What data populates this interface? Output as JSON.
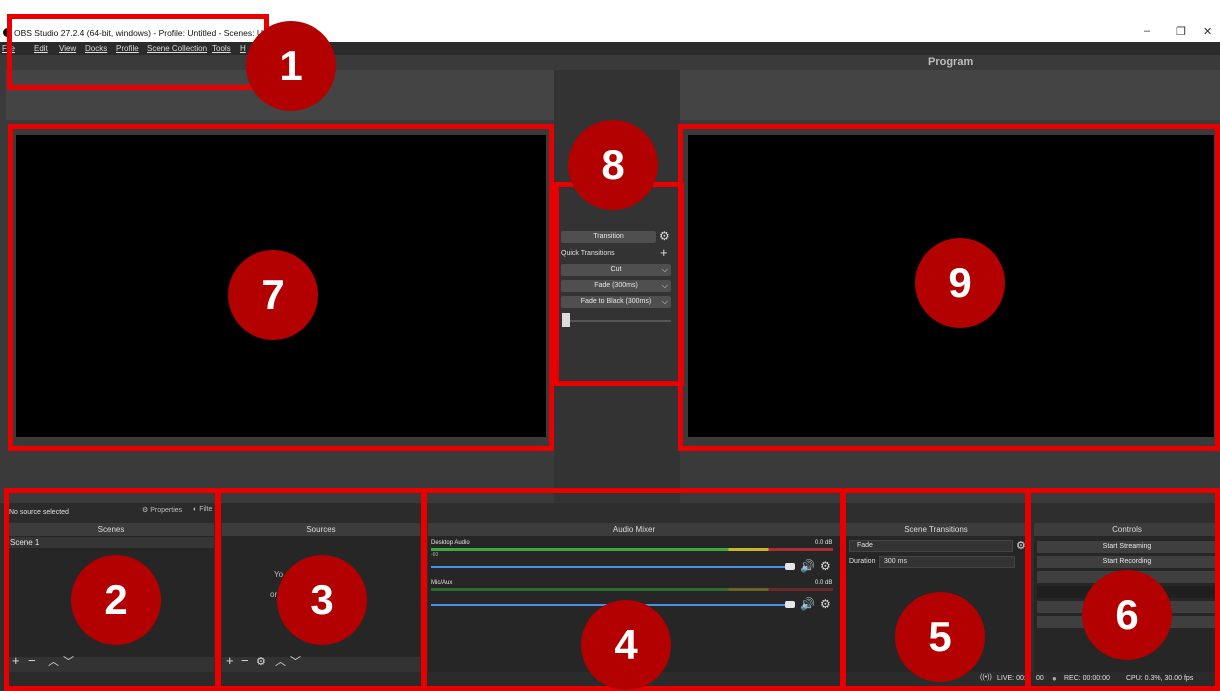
{
  "window": {
    "title": "OBS Studio 27.2.4 (64-bit, windows) - Profile: Untitled - Scenes: Untit",
    "minimize": "–",
    "restore": "❐",
    "close": "✕"
  },
  "menu": [
    "File",
    "Edit",
    "View",
    "Docks",
    "Profile",
    "Scene Collection",
    "Tools",
    "H"
  ],
  "program_label": "Program",
  "transitions_panel": {
    "transition_button": "Transition",
    "quick_transitions": "Quick Transitions",
    "items": [
      "Cut",
      "Fade (300ms)",
      "Fade to Black (300ms)"
    ]
  },
  "source_toolbar": {
    "status": "No source selected",
    "properties": "Properties",
    "filters": "Filte"
  },
  "scenes": {
    "header": "Scenes",
    "items": [
      "Scene 1"
    ]
  },
  "sources": {
    "header": "Sources",
    "hint_1": "Yo",
    "hint_2": "or"
  },
  "audio_mixer": {
    "header": "Audio Mixer",
    "channels": [
      {
        "name": "Desktop Audio",
        "level": "0.0 dB"
      },
      {
        "name": "Mic/Aux",
        "level": "0.0 dB"
      }
    ],
    "scale": [
      "-60",
      "-55",
      "-50",
      "-45",
      "-40",
      "-35",
      "-30",
      "-25",
      "-20",
      "-15",
      "-10",
      "-5",
      "0"
    ]
  },
  "scene_transitions": {
    "header": "Scene Transitions",
    "selected": "Fade",
    "duration_label": "Duration",
    "duration_value": "300 ms"
  },
  "controls": {
    "header": "Controls",
    "start_streaming": "Start Streaming",
    "start_recording": "Start Recording"
  },
  "status_bar": {
    "live": "LIVE: 00:",
    "live_tail": "00",
    "rec": "REC: 00:00:00",
    "cpu": "CPU: 0.3%, 30.00 fps"
  },
  "annotations": [
    "1",
    "2",
    "3",
    "4",
    "5",
    "6",
    "7",
    "8",
    "9"
  ],
  "colors": {
    "highlight": "#e80000",
    "badge": "#b30000",
    "meter_green": "#3ea83e",
    "meter_yellow": "#c8b825",
    "meter_red": "#a83030",
    "volume_blue": "#4a90e2"
  }
}
